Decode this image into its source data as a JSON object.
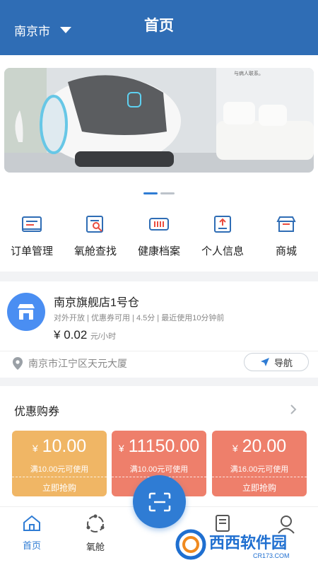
{
  "header": {
    "city": "南京市",
    "title": "首页"
  },
  "banner": {
    "caption": "与病人联系。",
    "pages": 2,
    "active_page": 1
  },
  "menu": [
    {
      "label": "订单管理",
      "icon": "order-icon"
    },
    {
      "label": "氧舱查找",
      "icon": "search-cabin-icon"
    },
    {
      "label": "健康档案",
      "icon": "health-record-icon"
    },
    {
      "label": "个人信息",
      "icon": "profile-info-icon"
    },
    {
      "label": "商城",
      "icon": "mall-icon"
    }
  ],
  "store": {
    "name": "南京旗舰店1号仓",
    "meta": "对外开放 | 优惠券可用 | 4.5分 | 最近使用10分钟前",
    "price_symbol": "¥",
    "price": "0.02",
    "price_unit": "元/小时",
    "address": "南京市江宁区天元大厦",
    "nav_label": "导航"
  },
  "coupons": {
    "title": "优惠购券",
    "items": [
      {
        "symbol": "¥",
        "amount": "10.00",
        "condition": "满10.00元可使用",
        "action": "立即抢购",
        "color": "#f0b665"
      },
      {
        "symbol": "¥",
        "amount": "11150.00",
        "condition": "满10.00元可使用",
        "action": "立即抢购",
        "color": "#ee7f6b"
      },
      {
        "symbol": "¥",
        "amount": "20.00",
        "condition": "满16.00元可使用",
        "action": "立即抢购",
        "color": "#ee7f6b"
      }
    ]
  },
  "tabbar": {
    "items": [
      {
        "label": "首页",
        "icon": "home-icon",
        "active": true
      },
      {
        "label": "氧舱",
        "icon": "cabin-icon",
        "active": false
      },
      {
        "label": "",
        "icon": "document-icon",
        "active": false
      },
      {
        "label": "",
        "icon": "user-icon",
        "active": false
      }
    ],
    "scan_icon": "scan-icon"
  },
  "watermark": {
    "text": "西西软件园",
    "sub": "CR173.COM"
  },
  "colors": {
    "primary": "#2f6db5",
    "accent": "#2f7cd4",
    "coupon_yellow": "#f0b665",
    "coupon_salmon": "#ee7f6b"
  }
}
